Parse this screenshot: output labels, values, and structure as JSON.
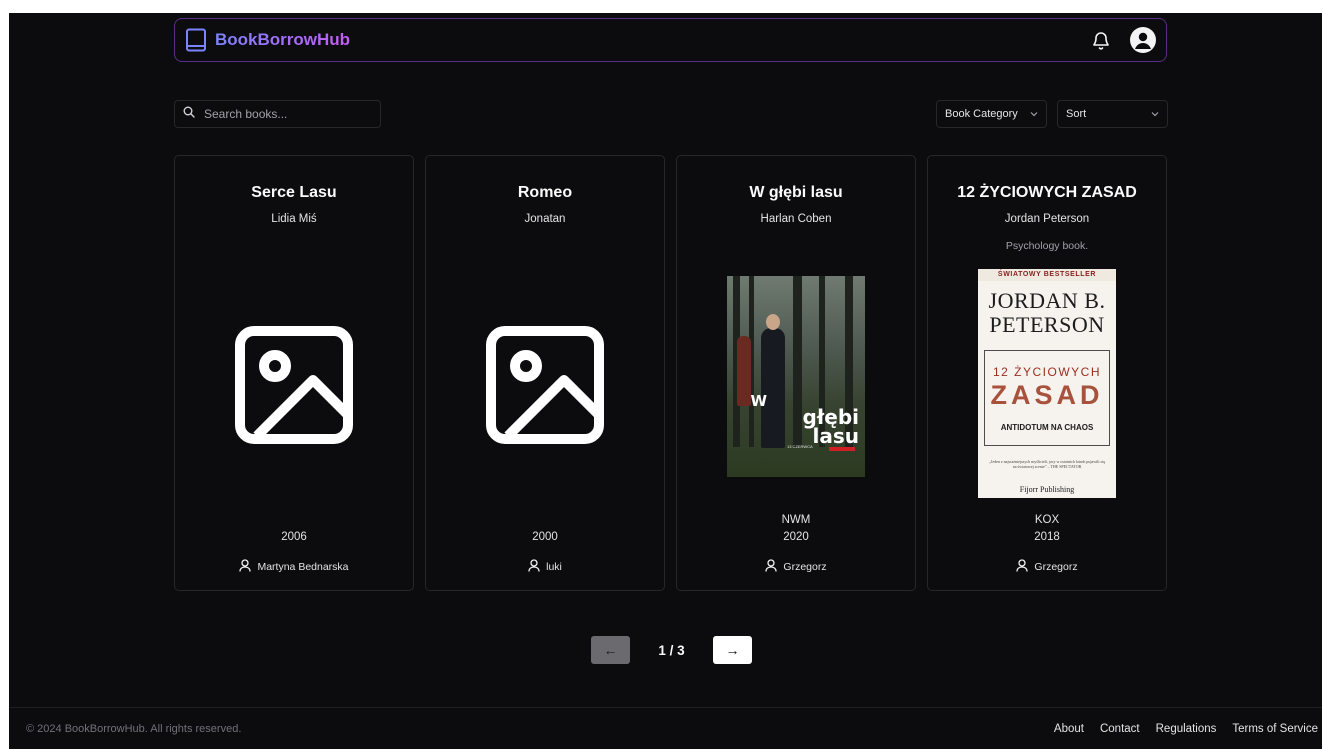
{
  "brand": {
    "name": "BookBorrowHub"
  },
  "search": {
    "placeholder": "Search books..."
  },
  "filters": {
    "category_label": "Book Category",
    "sort_label": "Sort"
  },
  "books": [
    {
      "title": "Serce Lasu",
      "author": "Lidia Miś",
      "description": "",
      "publisher": "",
      "year": "2006",
      "owner": "Martyna Bednarska",
      "cover": "placeholder"
    },
    {
      "title": "Romeo",
      "author": "Jonatan",
      "description": "",
      "publisher": "",
      "year": "2000",
      "owner": "luki",
      "cover": "placeholder"
    },
    {
      "title": "W głębi lasu",
      "author": "Harlan Coben",
      "description": "",
      "publisher": "NWM",
      "year": "2020",
      "owner": "Grzegorz",
      "cover": "forest-cover"
    },
    {
      "title": "12 ŻYCIOWYCH ZASAD",
      "author": "Jordan Peterson",
      "description": "Psychology book.",
      "publisher": "KOX",
      "year": "2018",
      "owner": "Grzegorz",
      "cover": "peterson-cover"
    }
  ],
  "covers": {
    "forest": {
      "title_line1": "W",
      "title_line2": "głębi",
      "title_line3": "lasu",
      "small_text": "13 CZERWCA"
    },
    "peterson": {
      "bestseller": "ŚWIATOWY BESTSELLER",
      "author_line1": "JORDAN B.",
      "author_line2": "PETERSON",
      "subtitle_top": "12 ŻYCIOWYCH",
      "subtitle_main": "ZASAD",
      "tagline": "ANTIDOTUM NA CHAOS",
      "quote": "„Jeden z najważniejszych myślicieli, jacy w ostatnich latach pojawili się na światowej scenie” – THE SPECTATOR",
      "publisher": "Fijorr Publishing"
    }
  },
  "pagination": {
    "prev": "←",
    "indicator": "1 / 3",
    "next": "→"
  },
  "footer": {
    "copyright": "© 2024 BookBorrowHub. All rights reserved.",
    "links": [
      "About",
      "Contact",
      "Regulations",
      "Terms of Service"
    ]
  },
  "icons": {
    "logo": "book-icon",
    "notifications": "bell-icon",
    "profile": "user-avatar-icon",
    "search": "search-icon",
    "dropdown": "chevron-down-icon",
    "owner": "user-icon",
    "placeholder": "image-placeholder-icon"
  },
  "colors": {
    "accent_start": "#7c83ff",
    "accent_end": "#c65bf5",
    "background": "#0c0c0e",
    "border": "#27272a"
  }
}
